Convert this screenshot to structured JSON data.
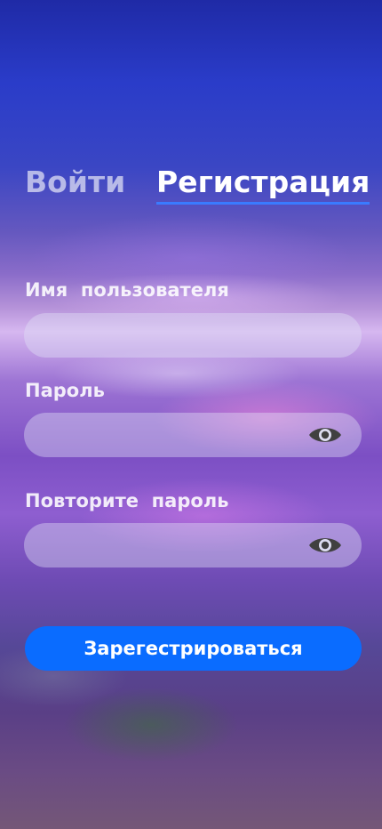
{
  "tabs": {
    "login_label": "Войти",
    "register_label": "Регистрация",
    "active": "register",
    "active_underline_color": "#3a7bff"
  },
  "form": {
    "username": {
      "label": "Имя  пользователя",
      "value": ""
    },
    "password": {
      "label": "Пароль",
      "value": "",
      "toggle_icon": "eye-icon"
    },
    "password_repeat": {
      "label": "Повторите  пароль",
      "value": "",
      "toggle_icon": "eye-icon"
    },
    "submit_label": "Зарегестрироваться",
    "submit_color": "#0a6cff"
  }
}
